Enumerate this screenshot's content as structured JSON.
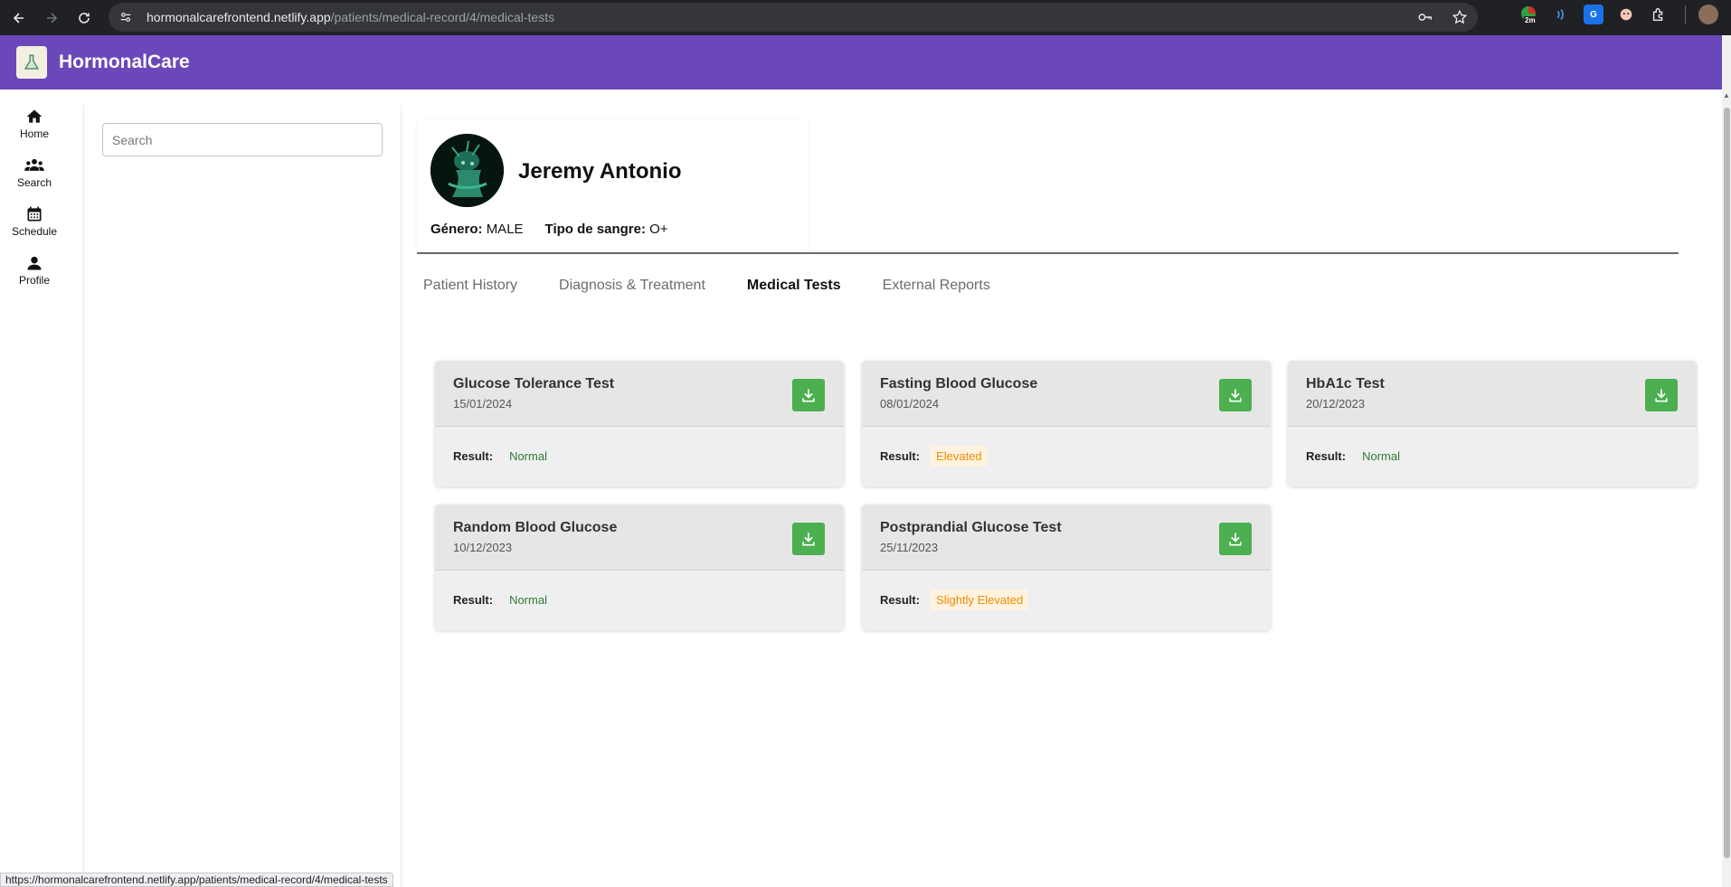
{
  "browser": {
    "url_host": "hormonalcarefrontend.netlify.app",
    "url_path": "/patients/medical-record/4/medical-tests",
    "ext_badge": "2m",
    "status_url": "https://hormonalcarefrontend.netlify.app/patients/medical-record/4/medical-tests"
  },
  "app": {
    "title": "HormonalCare"
  },
  "nav": {
    "items": [
      {
        "label": "Home",
        "icon": "home-icon"
      },
      {
        "label": "Search",
        "icon": "group-icon"
      },
      {
        "label": "Schedule",
        "icon": "calendar-icon"
      },
      {
        "label": "Profile",
        "icon": "person-icon"
      }
    ]
  },
  "search": {
    "placeholder": "Search"
  },
  "patient": {
    "name": "Jeremy Antonio",
    "gender_label": "Género:",
    "gender": "MALE",
    "blood_label": "Tipo de sangre:",
    "blood": "O+"
  },
  "tabs": [
    {
      "label": "Patient History",
      "active": false
    },
    {
      "label": "Diagnosis & Treatment",
      "active": false
    },
    {
      "label": "Medical Tests",
      "active": true
    },
    {
      "label": "External Reports",
      "active": false
    }
  ],
  "result_label": "Result:",
  "tests": [
    {
      "name": "Glucose Tolerance Test",
      "date": "15/01/2024",
      "result": "Normal",
      "status": "normal"
    },
    {
      "name": "Fasting Blood Glucose",
      "date": "08/01/2024",
      "result": "Elevated",
      "status": "elevated"
    },
    {
      "name": "HbA1c Test",
      "date": "20/12/2023",
      "result": "Normal",
      "status": "normal"
    },
    {
      "name": "Random Blood Glucose",
      "date": "10/12/2023",
      "result": "Normal",
      "status": "normal"
    },
    {
      "name": "Postprandial Glucose Test",
      "date": "25/11/2023",
      "result": "Slightly Elevated",
      "status": "elevated"
    }
  ],
  "colors": {
    "header": "#6b48b9",
    "download": "#4caf50",
    "normal": "#2e7d32",
    "elevated": "#ef8c00"
  }
}
